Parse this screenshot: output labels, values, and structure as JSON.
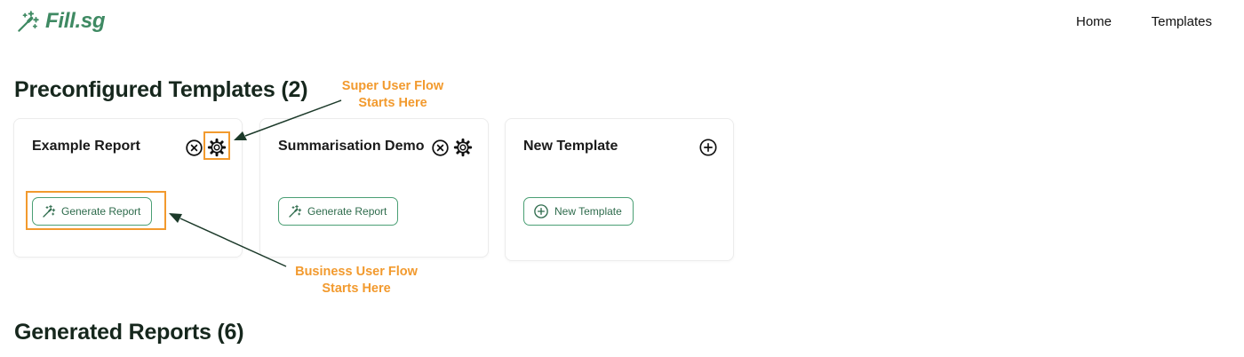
{
  "header": {
    "brand": "Fill.sg",
    "nav": [
      {
        "label": "Home"
      },
      {
        "label": "Templates"
      }
    ]
  },
  "preconfigured": {
    "title": "Preconfigured Templates (2)",
    "cards": [
      {
        "title": "Example Report",
        "action_label": "Generate Report",
        "icons": [
          "close-circle-icon",
          "gear-icon"
        ]
      },
      {
        "title": "Summarisation Demo",
        "action_label": "Generate Report",
        "icons": [
          "close-circle-icon",
          "gear-icon"
        ]
      },
      {
        "title": "New Template",
        "action_label": "New Template",
        "icons": [
          "plus-circle-icon"
        ]
      }
    ]
  },
  "annotations": {
    "super_user": {
      "line1": "Super User Flow",
      "line2": "Starts Here"
    },
    "business_user": {
      "line1": "Business User Flow",
      "line2": "Starts Here"
    },
    "color": "#f29a2e"
  },
  "generated": {
    "title": "Generated Reports (6)"
  },
  "colors": {
    "brand": "#3f8a63",
    "accent": "#4a9f74",
    "heading": "#16271d"
  }
}
